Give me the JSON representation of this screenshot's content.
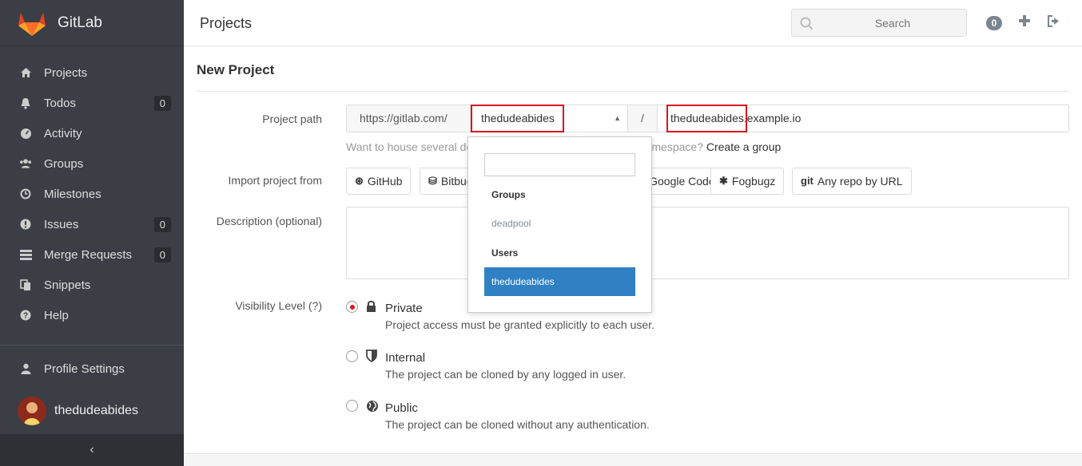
{
  "brand": {
    "name": "GitLab"
  },
  "sidebar": {
    "items": [
      {
        "label": "Projects",
        "icon": "home-icon"
      },
      {
        "label": "Todos",
        "icon": "bell-icon",
        "badge": "0"
      },
      {
        "label": "Activity",
        "icon": "dashboard-icon"
      },
      {
        "label": "Groups",
        "icon": "group-icon"
      },
      {
        "label": "Milestones",
        "icon": "clock-icon"
      },
      {
        "label": "Issues",
        "icon": "exclamation-icon",
        "badge": "0"
      },
      {
        "label": "Merge Requests",
        "icon": "list-icon",
        "badge": "0"
      },
      {
        "label": "Snippets",
        "icon": "copy-icon"
      },
      {
        "label": "Help",
        "icon": "question-icon"
      }
    ],
    "profile_settings": "Profile Settings",
    "username": "thedudeabides",
    "collapse": "‹"
  },
  "header": {
    "title": "Projects",
    "search_placeholder": "Search",
    "todo_count": "0"
  },
  "form": {
    "page_title": "New Project",
    "path_label": "Project path",
    "url_prefix": "https://gitlab.com/",
    "namespace": "thedudeabides",
    "slash": "/",
    "path_value": "thedudeabides.example.io",
    "help_text": "Want to house several dependent projects under the same namespace?",
    "create_group": "Create a group",
    "import_label": "Import project from",
    "import_sources": [
      "GitHub",
      "Bitbucket",
      "Google Code",
      "Fogbugz",
      "Any repo by URL"
    ],
    "description_label": "Description (optional)",
    "visibility_label": "Visibility Level (?)",
    "visibility": [
      {
        "title": "Private",
        "desc": "Project access must be granted explicitly to each user.",
        "selected": true
      },
      {
        "title": "Internal",
        "desc": "The project can be cloned by any logged in user.",
        "selected": false
      },
      {
        "title": "Public",
        "desc": "The project can be cloned without any authentication.",
        "selected": false
      }
    ]
  },
  "dropdown": {
    "groups_header": "Groups",
    "group_item": "deadpool",
    "users_header": "Users",
    "user_item": "thedudeabides"
  },
  "colors": {
    "sidebar": "#3b3e45",
    "accent_red": "#d9171e",
    "selected_blue": "#2f81c4"
  }
}
